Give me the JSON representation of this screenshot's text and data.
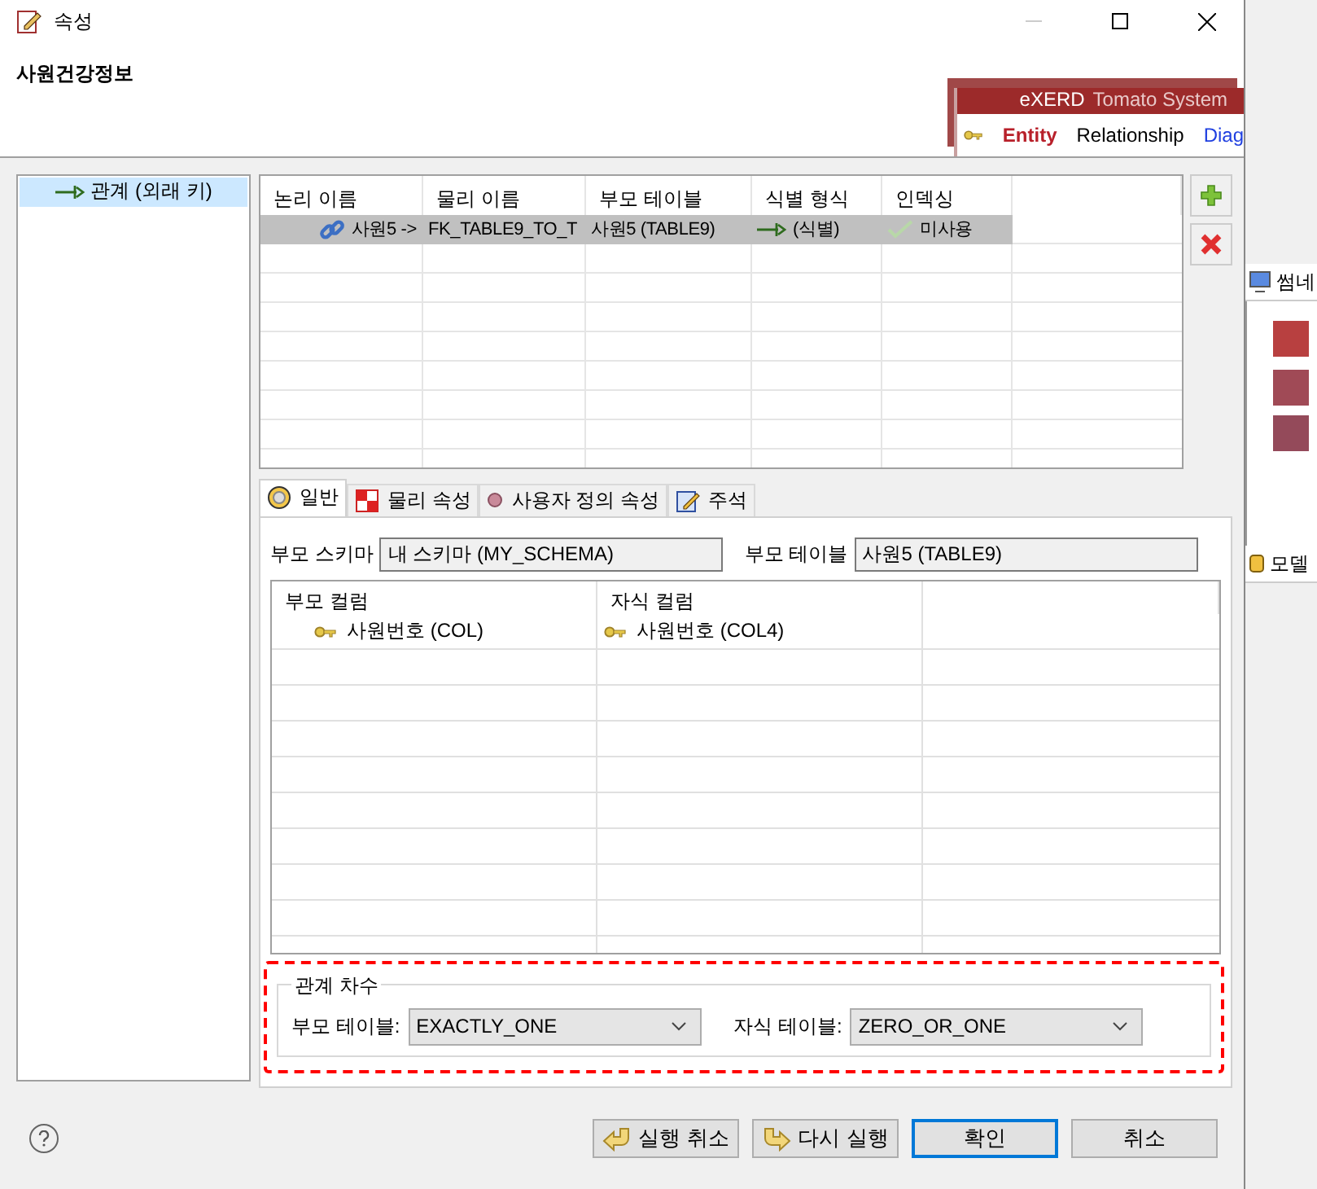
{
  "window": {
    "title": "속성"
  },
  "header": {
    "title": "사원건강정보",
    "banner": {
      "brand": "eXERD",
      "subtitle": "Tomato System",
      "tabs": [
        {
          "label": "Entity",
          "selected": true
        },
        {
          "label": "Relationship",
          "selected": false
        },
        {
          "label": "Diag",
          "selected": false
        }
      ]
    }
  },
  "tree": {
    "items": [
      {
        "label": "관계 (외래 키)",
        "selected": true
      }
    ]
  },
  "relations_table": {
    "columns": [
      "논리 이름",
      "물리 이름",
      "부모 테이블",
      "식별 형식",
      "인덱싱"
    ],
    "rows": [
      {
        "selected": true,
        "cells": [
          "사원5 ->",
          "FK_TABLE9_TO_T",
          "사원5 (TABLE9)",
          "(식별)",
          "미사용"
        ]
      }
    ]
  },
  "tabs": [
    {
      "label": "일반",
      "kind": "general",
      "selected": true
    },
    {
      "label": "물리 속성",
      "kind": "physical",
      "selected": false
    },
    {
      "label": "사용자 정의 속성",
      "kind": "user",
      "selected": false
    },
    {
      "label": "주석",
      "kind": "comment",
      "selected": false
    }
  ],
  "general": {
    "parent_schema": {
      "label": "부모 스키마",
      "value": "내 스키마 (MY_SCHEMA)"
    },
    "parent_table": {
      "label": "부모 테이블",
      "value": "사원5 (TABLE9)"
    },
    "columns_table": {
      "columns": [
        "부모 컬럼",
        "자식 컬럼"
      ],
      "rows": [
        [
          "사원번호 (COL)",
          "사원번호 (COL4)"
        ]
      ]
    }
  },
  "cardinality": {
    "title": "관계 차수",
    "parent": {
      "label": "부모 테이블:",
      "value": "EXACTLY_ONE"
    },
    "child": {
      "label": "자식 테이블:",
      "value": "ZERO_OR_ONE"
    }
  },
  "buttons": [
    {
      "label": "실행 취소",
      "kind": "undo"
    },
    {
      "label": "다시 실행",
      "kind": "redo"
    },
    {
      "label": "확인",
      "kind": "default"
    },
    {
      "label": "취소",
      "kind": "plain"
    }
  ],
  "background": {
    "panels": [
      "썸네",
      "모델"
    ]
  }
}
